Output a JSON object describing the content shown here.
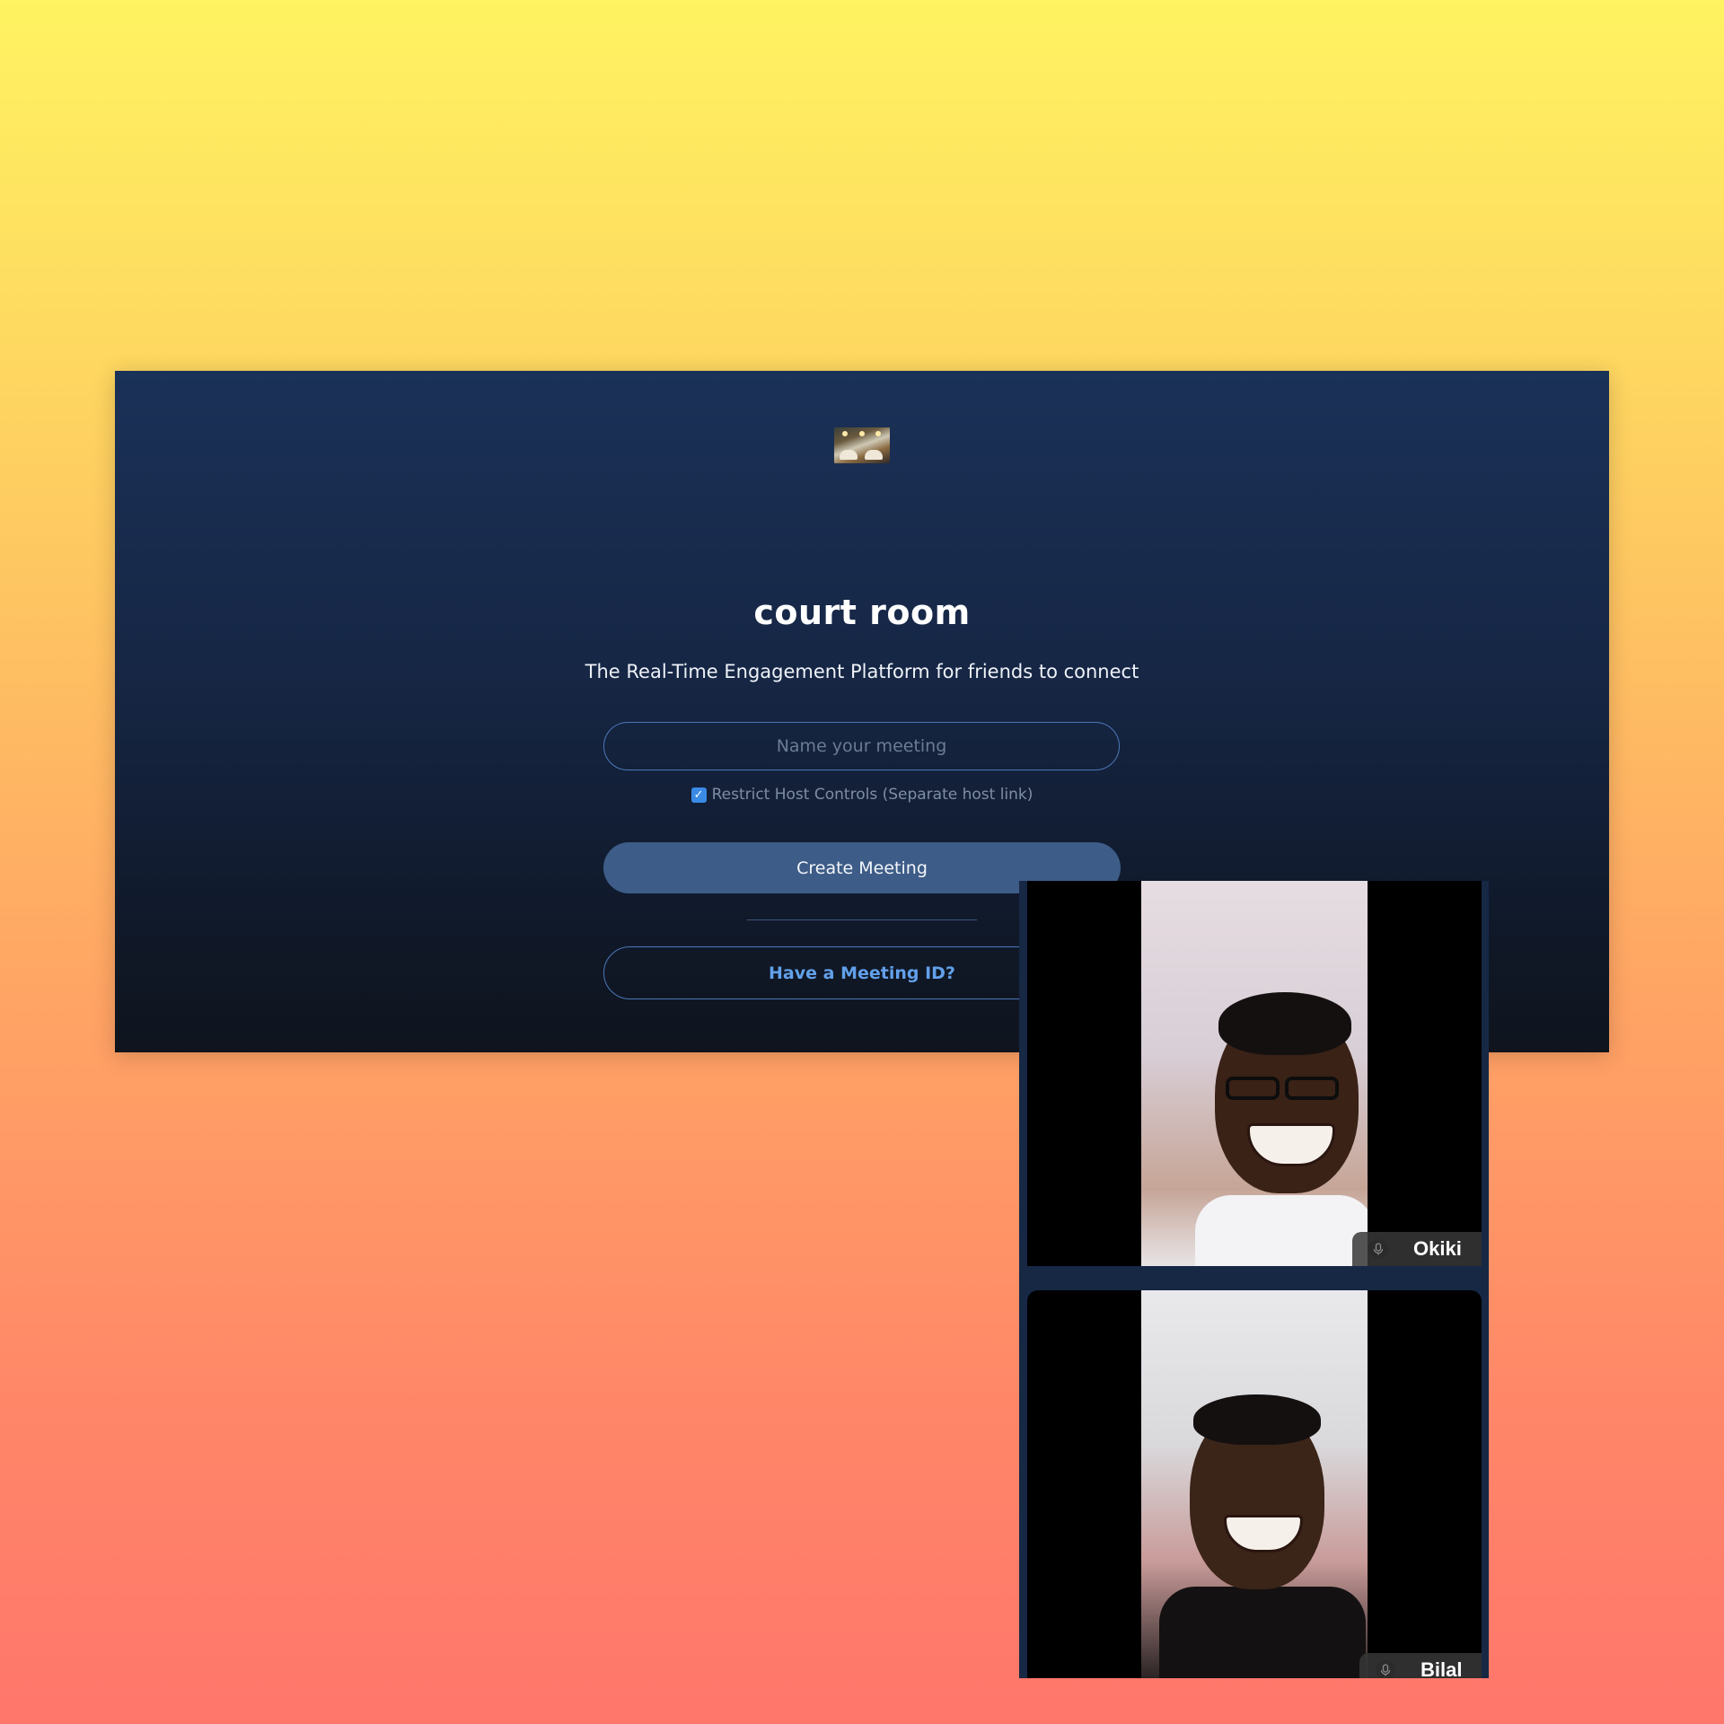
{
  "app": {
    "title": "court room",
    "subtitle": "The Real-Time Engagement Platform for friends to connect",
    "logo_icon": "group-photo-logo"
  },
  "meeting_form": {
    "name_placeholder": "Name your meeting",
    "name_value": "",
    "restrict_checked": true,
    "restrict_label": "Restrict Host Controls (Separate host link)",
    "create_label": "Create Meeting",
    "meeting_id_label": "Have a Meeting ID?"
  },
  "participants": [
    {
      "name": "Okiki",
      "mic_icon": "microphone-icon"
    },
    {
      "name": "Bilal",
      "mic_icon": "microphone-icon"
    }
  ],
  "colors": {
    "accent": "#3a8ae6",
    "button_fill": "#3d5c87",
    "link_text": "#62a0ea",
    "panel_top": "#1a3158",
    "panel_bottom": "#0f141d"
  }
}
